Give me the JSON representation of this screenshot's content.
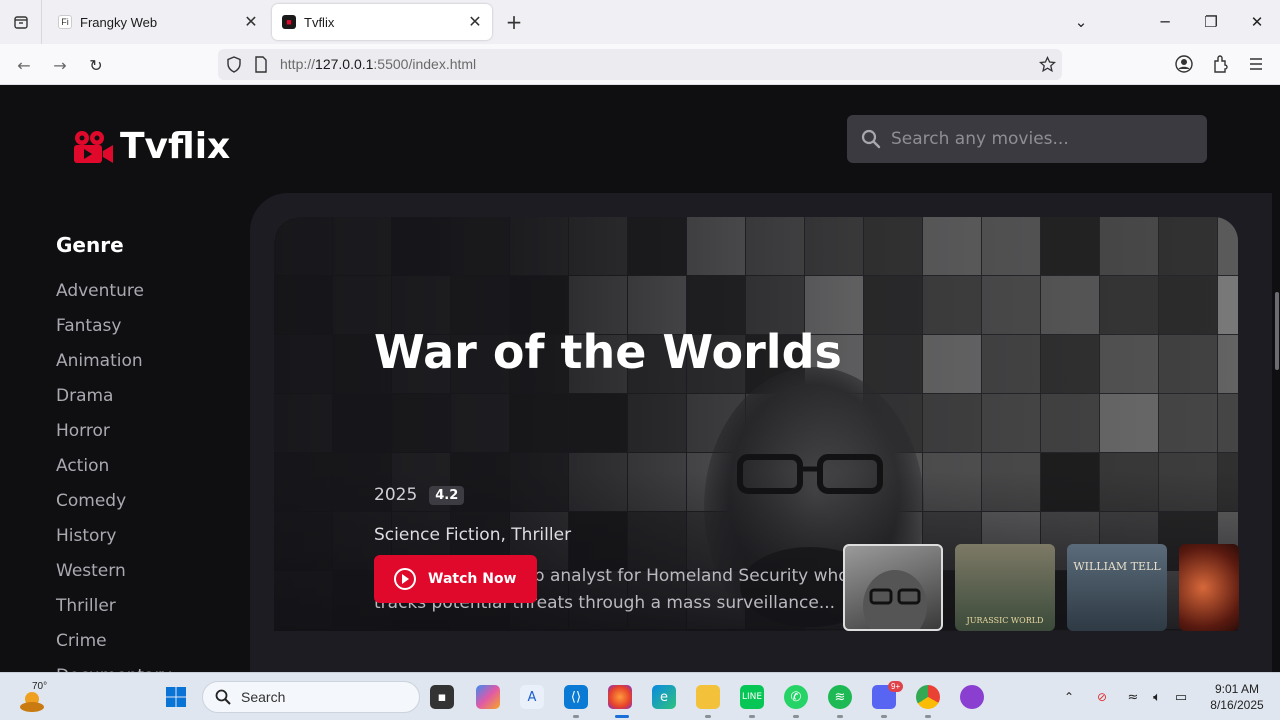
{
  "browser": {
    "tabs": [
      {
        "title": "Frangky Web",
        "favicon_text": "Fi"
      },
      {
        "title": "Tvflix",
        "active": true
      }
    ],
    "url_prefix": "http://",
    "url_host": "127.0.0.1",
    "url_rest": ":5500/index.html"
  },
  "site": {
    "logo_text": "Tvflix",
    "brand_color": "#e0092b",
    "search_placeholder": "Search any movies..."
  },
  "sidebar": {
    "title": "Genre",
    "genres": [
      "Adventure",
      "Fantasy",
      "Animation",
      "Drama",
      "Horror",
      "Action",
      "Comedy",
      "History",
      "Western",
      "Thriller",
      "Crime",
      "Documentary"
    ]
  },
  "banner": {
    "title": "War of the Worlds",
    "year": "2025",
    "rating": "4.2",
    "genres": "Science Fiction, Thriller",
    "description": "Will Radford is a top analyst for Homeland Security who tracks potential threats through a mass surveillance...",
    "watch_label": "Watch Now",
    "thumbnails": [
      {
        "label": "",
        "icon": "poster-war-of-the-worlds"
      },
      {
        "label": "JURASSIC WORLD",
        "icon": "poster-jurassic-world"
      },
      {
        "label": "WILLIAM TELL",
        "icon": "poster-william-tell"
      },
      {
        "label": "",
        "icon": "poster-fire"
      }
    ]
  },
  "taskbar": {
    "weather_temp": "70°",
    "search_label": "Search",
    "time": "9:01 AM",
    "date": "8/16/2025",
    "notification_badge": "9+"
  }
}
